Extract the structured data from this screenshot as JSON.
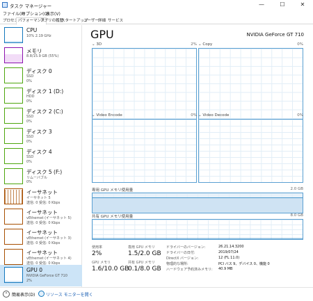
{
  "window": {
    "title": "タスク マネージャー",
    "minimize": "—",
    "maximize": "☐",
    "close": "✕"
  },
  "menu": [
    "ファイル(F)",
    "オプション(O)",
    "表示(V)"
  ],
  "tabs": [
    "プロセス",
    "パフォーマンス",
    "アプリの履歴",
    "スタートアップ",
    "ユーザー",
    "詳細",
    "サービス"
  ],
  "active_tab": "パフォーマンス",
  "sidebar": [
    {
      "name": "CPU",
      "sub": "10%  2.19 GHz",
      "sub2": ""
    },
    {
      "name": "メモリ",
      "sub": "8.8/15.9 GB (55%)",
      "sub2": ""
    },
    {
      "name": "ディスク 0",
      "sub": "SSD",
      "sub2": "0%"
    },
    {
      "name": "ディスク 1 (D:)",
      "sub": "HDD",
      "sub2": "0%"
    },
    {
      "name": "ディスク 2 (C:)",
      "sub": "SSD",
      "sub2": "0%"
    },
    {
      "name": "ディスク 3",
      "sub": "SSD",
      "sub2": "0%"
    },
    {
      "name": "ディスク 4",
      "sub": "SSD",
      "sub2": "0%"
    },
    {
      "name": "ディスク 5 (F:)",
      "sub": "リムーバブル",
      "sub2": "0%"
    },
    {
      "name": "イーサネット",
      "sub": "イーサネット 5",
      "sub2": "送信: 0 受信: 0 Kbps"
    },
    {
      "name": "イーサネット",
      "sub": "vEthernet (イーサネット 5)",
      "sub2": "送信: 0 受信: 0 Kbps"
    },
    {
      "name": "イーサネット",
      "sub": "vEthernet (イーサネット 3)",
      "sub2": "送信: 0 受信: 0 Kbps"
    },
    {
      "name": "イーサネット",
      "sub": "vEthernet (イーサネット 4)",
      "sub2": "送信: 0 受信: 0 Kbps"
    },
    {
      "name": "GPU 0",
      "sub": "NVIDIA GeForce GT 710",
      "sub2": "2%"
    }
  ],
  "gpu": {
    "title": "GPU",
    "model": "NVIDIA GeForce GT 710",
    "engines": [
      {
        "name": "3D",
        "pct": "2%"
      },
      {
        "name": "Copy",
        "pct": "0%"
      },
      {
        "name": "Video Encode",
        "pct": "0%"
      },
      {
        "name": "Video Decode",
        "pct": "0%"
      }
    ],
    "dedicated_label": "専用 GPU メモリ使用量",
    "dedicated_max": "2.0 GB",
    "shared_label": "共有 GPU メモリ使用量",
    "shared_max": "8.0 GB",
    "stats": {
      "usage_label": "使用率",
      "usage": "2%",
      "ded_label": "専用 GPU メモリ",
      "ded": "1.5/2.0 GB",
      "gpu_mem_label": "GPU メモリ",
      "gpu_mem": "1.6/10.0 GB",
      "shared_mem_label": "共有 GPU メモリ",
      "shared_mem": "0.1/8.0 GB"
    },
    "details": [
      {
        "k": "ドライバーのバージョン:",
        "v": "26.21.14.3200"
      },
      {
        "k": "ドライバーの日付:",
        "v": "2019/07/24"
      },
      {
        "k": "DirectX バージョン:",
        "v": "12 (FL 11.0)"
      },
      {
        "k": "物理的な場所:",
        "v": "PCI バス 9、デバイス 0、機能 0"
      },
      {
        "k": "ハードウェア予約済みメモリ:",
        "v": "40.9 MB"
      }
    ]
  },
  "footer": {
    "less": "簡易表示(D)",
    "resmon": "リソース モニターを開く"
  },
  "colors": {
    "cpu": "#1277bd",
    "memory": "#8b12ae",
    "disk": "#4da60c",
    "ethernet": "#a74f01",
    "gpu": "#1277bd",
    "selected": "#cce4f7"
  }
}
